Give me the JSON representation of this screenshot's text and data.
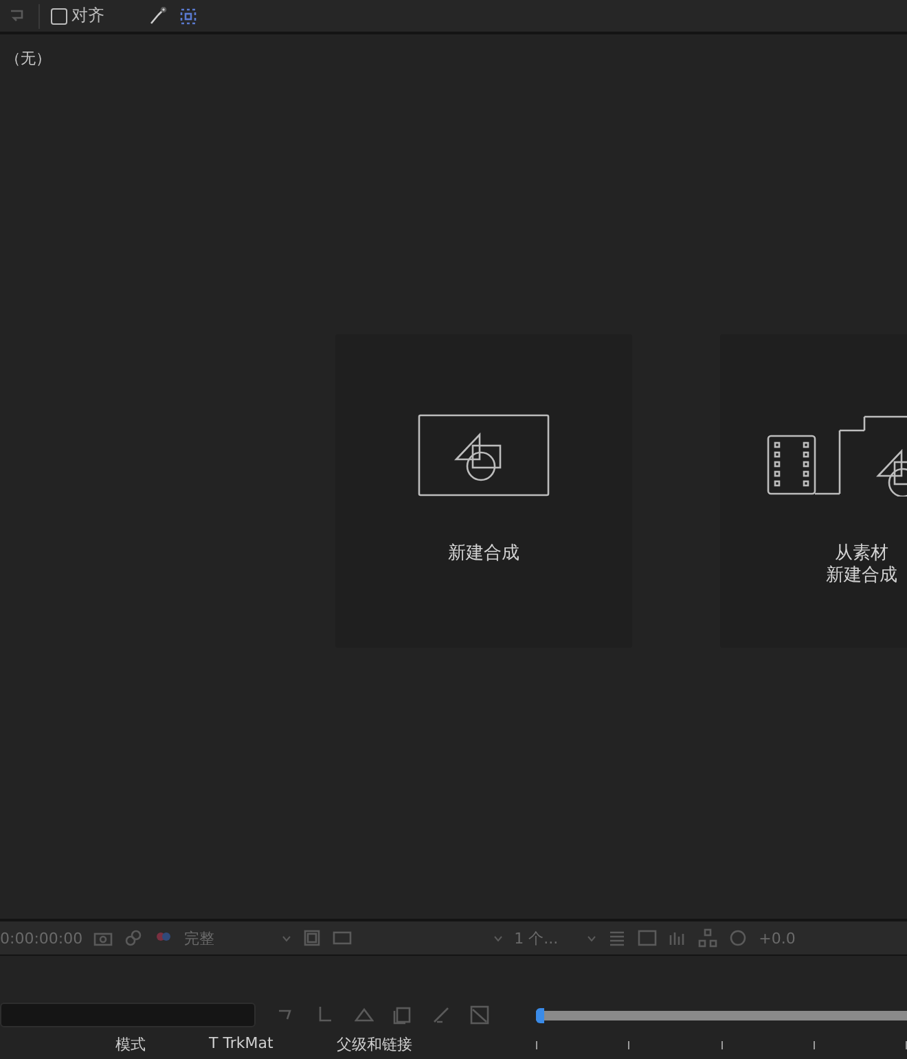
{
  "toolbar": {
    "align": {
      "label": "对齐",
      "checked": false
    }
  },
  "viewer": {
    "label": "（无）",
    "cards": [
      {
        "kind": "new",
        "lines": [
          "新建合成"
        ]
      },
      {
        "kind": "footage",
        "lines": [
          "从素材",
          "新建合成"
        ]
      }
    ]
  },
  "viewer_footer": {
    "timecode": "0:00:00:00",
    "resolution": "完整",
    "views": "1 个...",
    "exposure": "+0.0"
  },
  "timeline": {
    "columns": [
      "模式",
      "T TrkMat",
      "父级和链接"
    ],
    "playhead": {
      "level": 0
    }
  }
}
